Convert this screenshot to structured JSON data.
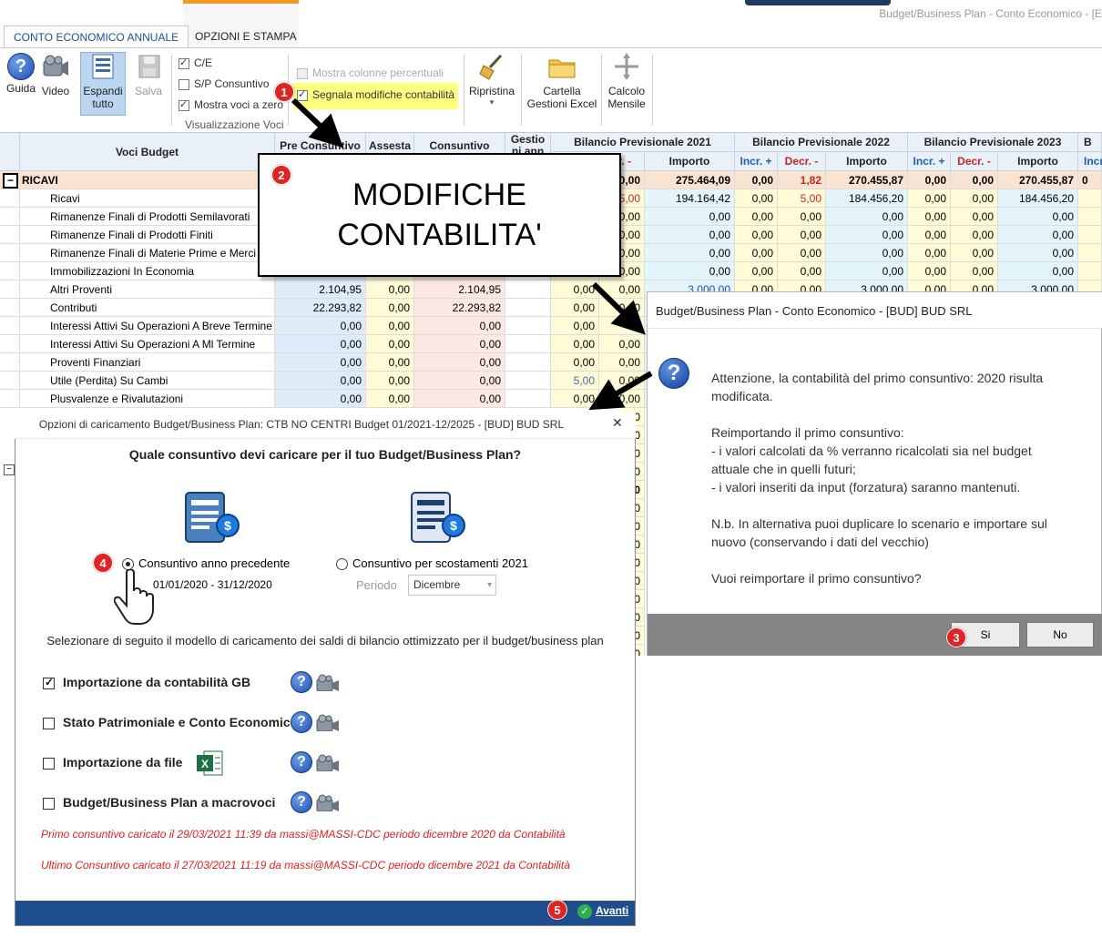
{
  "window_title": "Budget/Business Plan - Conto Economico - [E",
  "tabs": [
    "CONTO ECONOMICO ANNUALE",
    "OPZIONI E STAMPA"
  ],
  "ribbon": {
    "guida": "Guida",
    "video": "Video",
    "espandi1": "Espandi",
    "espandi2": "tutto",
    "salva": "Salva",
    "ce": "C/E",
    "sp": "S/P Consuntivo",
    "mostra_zero": "Mostra voci a zero",
    "vis_group": "Visualizzazione Voci",
    "mostra_perc": "Mostra colonne percentuali",
    "segnala": "Segnala modifiche contabilità",
    "ripristina": "Ripristina",
    "cartella1": "Cartella",
    "cartella2": "Gestioni Excel",
    "calcolo1": "Calcolo",
    "calcolo2": "Mensile"
  },
  "grid": {
    "headers": {
      "voci": "Voci Budget",
      "pre": "Pre Consuntivo",
      "assesta": "Assesta",
      "consuntivo": "Consuntivo",
      "gestio1": "Gestio",
      "gestio2": "ni ann",
      "b2021": "Bilancio Previsionale 2021",
      "b2022": "Bilancio Previsionale 2022",
      "b2023": "Bilancio Previsionale 2023",
      "bx": "B",
      "incr": "Incr. +",
      "decr": "Decr. -",
      "decr_short": "cr. -",
      "importo": "Importo",
      "incr_short": "Incr"
    },
    "section_ricavi": "RICAVI",
    "ricavi_row": {
      "i21": "0,00",
      "imp21": "275.464,09",
      "inc22": "0,00",
      "dec22": "1,82",
      "imp22": "270.455,87",
      "inc23": "0,00",
      "dec23": "0,00",
      "imp23": "270.455,87",
      "last": "0"
    },
    "rows": [
      {
        "label": "Ricavi",
        "pre": "",
        "ass": "",
        "con": "",
        "g": "",
        "inc21": "",
        "dec21": "5,00",
        "imp21": "194.164,42",
        "inc22": "0,00",
        "dec22": "5,00",
        "imp22": "184.456,20",
        "inc23": "0,00",
        "dec23": "0,00",
        "imp23": "184.456,20"
      },
      {
        "label": "Rimanenze Finali di Prodotti Semilavorati",
        "pre": "",
        "ass": "",
        "con": "",
        "g": "",
        "inc21": "",
        "dec21": "0,00",
        "imp21": "0,00",
        "inc22": "0,00",
        "dec22": "0,00",
        "imp22": "0,00",
        "inc23": "0,00",
        "dec23": "0,00",
        "imp23": "0,00"
      },
      {
        "label": "Rimanenze Finali di Prodotti Finiti",
        "pre": "",
        "ass": "",
        "con": "",
        "g": "",
        "inc21": "",
        "dec21": "0,00",
        "imp21": "0,00",
        "inc22": "0,00",
        "dec22": "0,00",
        "imp22": "0,00",
        "inc23": "0,00",
        "dec23": "0,00",
        "imp23": "0,00"
      },
      {
        "label": "Rimanenze Finali di Materie Prime e Merci",
        "pre": "",
        "ass": "",
        "con": "",
        "g": "",
        "inc21": "",
        "dec21": "0,00",
        "imp21": "0,00",
        "inc22": "0,00",
        "dec22": "0,00",
        "imp22": "0,00",
        "inc23": "0,00",
        "dec23": "0,00",
        "imp23": "0,00"
      },
      {
        "label": "Immobilizzazioni In Economia",
        "pre": "",
        "ass": "",
        "con": "",
        "g": "",
        "inc21": "",
        "dec21": "0,00",
        "imp21": "0,00",
        "inc22": "0,00",
        "dec22": "0,00",
        "imp22": "0,00",
        "inc23": "0,00",
        "dec23": "0,00",
        "imp23": "0,00"
      },
      {
        "label": "Altri Proventi",
        "pre": "2.104,95",
        "ass": "0,00",
        "con": "2.104,95",
        "g": "",
        "inc21": "0,00",
        "dec21": "0,00",
        "imp21": "3.000,00",
        "inc22": "0,00",
        "dec22": "0,00",
        "imp22": "3.000,00",
        "inc23": "0,00",
        "dec23": "0,00",
        "imp23": "3.000,00"
      },
      {
        "label": "Contributi",
        "pre": "22.293,82",
        "ass": "0,00",
        "con": "22.293,82",
        "g": "",
        "inc21": "0,00",
        "dec21": "0,00",
        "imp21": "",
        "inc22": "",
        "dec22": "",
        "imp22": "",
        "inc23": "",
        "dec23": "",
        "imp23": ""
      },
      {
        "label": "Interessi Attivi Su Operazioni A Breve Termine",
        "pre": "0,00",
        "ass": "0,00",
        "con": "0,00",
        "g": "",
        "inc21": "0,00",
        "dec21": "",
        "imp21": "",
        "inc22": "",
        "dec22": "",
        "imp22": "",
        "inc23": "",
        "dec23": "",
        "imp23": ""
      },
      {
        "label": "Interessi Attivi Su Operazioni A Ml Termine",
        "pre": "0,00",
        "ass": "0,00",
        "con": "0,00",
        "g": "",
        "inc21": "0,00",
        "dec21": "0,00",
        "imp21": "",
        "inc22": "",
        "dec22": "",
        "imp22": "",
        "inc23": "",
        "dec23": "",
        "imp23": ""
      },
      {
        "label": "Proventi Finanziari",
        "pre": "0,00",
        "ass": "0,00",
        "con": "0,00",
        "g": "",
        "inc21": "0,00",
        "dec21": "0,00",
        "imp21": "",
        "inc22": "",
        "dec22": "",
        "imp22": "",
        "inc23": "",
        "dec23": "",
        "imp23": ""
      },
      {
        "label": "Utile (Perdita) Su Cambi",
        "pre": "0,00",
        "ass": "0,00",
        "con": "0,00",
        "g": "",
        "inc21": "5,00",
        "dec21": "0,00",
        "imp21": "",
        "inc22": "",
        "dec22": "",
        "imp22": "",
        "inc23": "",
        "dec23": "",
        "imp23": ""
      },
      {
        "label": "Plusvalenze e Rivalutazioni",
        "pre": "0,00",
        "ass": "0,00",
        "con": "0,00",
        "g": "",
        "inc21": "0,00",
        "dec21": "0,00",
        "imp21": "",
        "inc22": "",
        "dec22": "",
        "imp22": "",
        "inc23": "",
        "dec23": "",
        "imp23": ""
      }
    ],
    "right_stub": [
      "00",
      "00",
      "00",
      "00",
      "0",
      "00",
      "00",
      "00",
      "00",
      "00",
      "00",
      "00",
      "00",
      "00"
    ]
  },
  "callouts": {
    "n1": "1",
    "n2": "2",
    "n3": "3",
    "n4": "4",
    "n5": "5",
    "big_line1": "MODIFICHE",
    "big_line2": "CONTABILITA'"
  },
  "dialog_right": {
    "title": "Budget/Business Plan - Conto Economico - [BUD] BUD SRL",
    "p1a": "Attenzione, la contabilità del primo consuntivo: 2020 risulta",
    "p1b": "modificata.",
    "p2a": "Reimportando il primo consuntivo:",
    "p2b": "- i valori calcolati da % verranno ricalcolati sia nel budget",
    "p2c": "attuale che in quelli futuri;",
    "p2d": "- i valori inseriti da input (forzatura) saranno mantenuti.",
    "p3a": "N.b. In alternativa puoi duplicare lo scenario e importare sul",
    "p3b": "nuovo (conservando i dati del vecchio)",
    "p4": "Vuoi reimportare il primo consuntivo?",
    "yes": "Si",
    "no": "No"
  },
  "dialog_left": {
    "title": "Opzioni di caricamento Budget/Business Plan: CTB NO CENTRI Budget 01/2021-12/2025 - [BUD] BUD SRL",
    "close": "✕",
    "question": "Quale consuntivo devi caricare per il tuo Budget/Business Plan?",
    "opt_prev": "Consuntivo anno precedente",
    "opt_prev_dates": "01/01/2020 - 31/12/2020",
    "opt_scost": "Consuntivo per scostamenti 2021",
    "periodo_label": "Periodo",
    "periodo_value": "Dicembre",
    "select_text": "Selezionare di seguito il modello di caricamento dei saldi di bilancio ottimizzato per il budget/business plan",
    "models": [
      "Importazione da contabilità GB",
      "Stato Patrimoniale e Conto Economico",
      "Importazione da file",
      "Budget/Business Plan a macrovoci"
    ],
    "primo": "Primo consuntivo caricato il 29/03/2021 11:39 da massi@MASSI-CDC periodo dicembre 2020 da Contabilità",
    "ultimo": "Ultimo Consuntivo caricato il 27/03/2021 11:19 da massi@MASSI-CDC periodo dicembre 2021 da Contabilità",
    "avanti": "Avanti"
  },
  "colors": {
    "accent": "#1f4e8f",
    "callout": "#e02424",
    "highlight": "#ffff80",
    "section": "#fbe3d2"
  }
}
